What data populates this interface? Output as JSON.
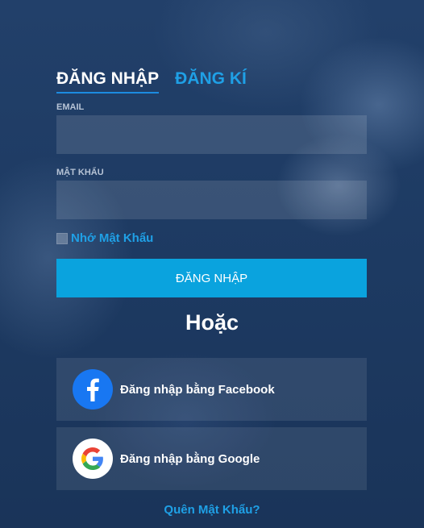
{
  "tabs": {
    "login": "ĐĂNG NHẬP",
    "register": "ĐĂNG KÍ"
  },
  "form": {
    "email_label": "EMAIL",
    "email_value": "",
    "password_label": "MẬT KHẨU",
    "password_value": "",
    "remember_label": "Nhớ Mật Khẩu",
    "submit_label": "ĐĂNG NHẬP"
  },
  "divider": "Hoặc",
  "social": {
    "facebook_label": "Đăng nhập bằng Facebook",
    "google_label": "Đăng nhập bằng Google"
  },
  "forgot_label": "Quên Mật Khẩu?",
  "colors": {
    "accent": "#1fa0e6",
    "button": "#0aa3de",
    "facebook": "#1877f2"
  }
}
